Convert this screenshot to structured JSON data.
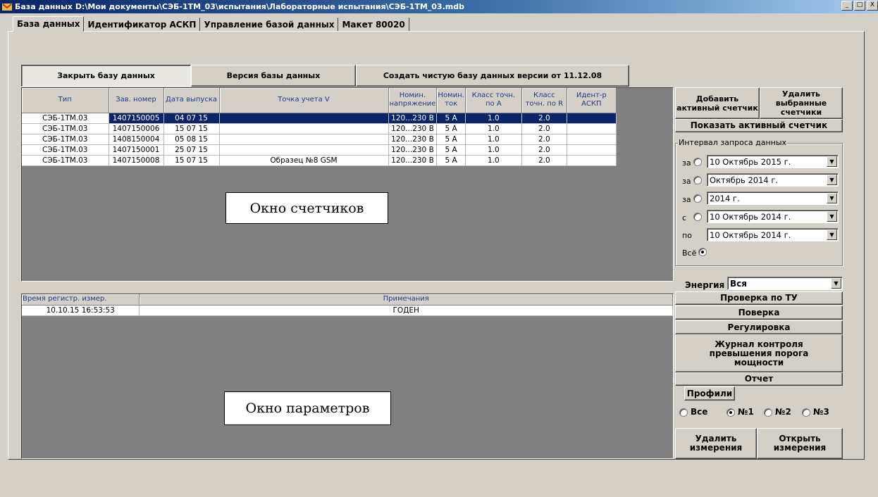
{
  "window": {
    "title": "База данных D:\\Мои документы\\СЭБ-1ТМ_03\\испытания\\Лабораторные испытания\\СЭБ-1ТМ_03.mdb",
    "controls": [
      "_",
      "□",
      "X"
    ]
  },
  "tabs": [
    {
      "label": "База данных",
      "active": true
    },
    {
      "label": "Идентификатор АСКП",
      "active": false
    },
    {
      "label": "Управление базой данных",
      "active": false
    },
    {
      "label": "Макет 80020",
      "active": false
    }
  ],
  "toolbar": {
    "close_db": "Закрыть базу данных",
    "db_version": "Версия базы данных",
    "create_db": "Создать чистую базу данных версии от 11.12.08"
  },
  "meters_table": {
    "columns": [
      "Тип",
      "Зав. номер",
      "Дата выпуска",
      "Точка учета V",
      "Номин. напряжение",
      "Номин. ток",
      "Класс точн. по А",
      "Класс точн. по R",
      "Идент-р АСКП"
    ],
    "rows": [
      [
        "СЭБ-1ТМ.03",
        "1407150005",
        "04 07 15",
        "",
        "120...230 В",
        "5 А",
        "1.0",
        "2.0",
        ""
      ],
      [
        "СЭБ-1ТМ.03",
        "1407150006",
        "15 07 15",
        "",
        "120...230 В",
        "5 А",
        "1.0",
        "2.0",
        ""
      ],
      [
        "СЭБ-1ТМ.03",
        "1408150004",
        "05 08 15",
        "",
        "120...230 В",
        "5 А",
        "1.0",
        "2.0",
        ""
      ],
      [
        "СЭБ-1ТМ.03",
        "1407150001",
        "25 07 15",
        "",
        "120...230 В",
        "5 А",
        "1.0",
        "2.0",
        ""
      ],
      [
        "СЭБ-1ТМ.03",
        "1407150008",
        "15 07 15",
        "Образец №8 GSM",
        "120...230 В",
        "5 А",
        "1.0",
        "2.0",
        ""
      ]
    ],
    "callout": "Окно счетчиков"
  },
  "params_table": {
    "columns": [
      "Время регистр. измер.",
      "Примечания"
    ],
    "rows": [
      [
        "10.10.15 16:53:53",
        "ГОДЕН"
      ]
    ],
    "callout": "Окно параметров"
  },
  "side": {
    "add_active": "Добавить активный счетчик",
    "delete_selected": "Удалить выбранные счетчики",
    "show_active": "Показать активный счетчик",
    "interval_label": "Интервал запроса данных",
    "intervals": [
      {
        "label": "за",
        "value": "10 Октябрь 2015 г.",
        "selected": false
      },
      {
        "label": "за",
        "value": "Октябрь 2014 г.",
        "selected": false
      },
      {
        "label": "за",
        "value": "2014 г.",
        "selected": false
      },
      {
        "label": "с",
        "value": "10 Октябрь 2014 г.",
        "selected": false
      },
      {
        "label": "по",
        "value": "10 Октябрь 2014 г."
      }
    ],
    "all_label": "Всё",
    "all_selected": true,
    "energy_label": "Энергия",
    "energy_value": "Вся",
    "tu_check": "Проверка по ТУ",
    "verification": "Поверка",
    "adjustment": "Регулировка",
    "power_log": "Журнал контроля превышения порога мощности",
    "report": "Отчет",
    "profiles": "Профили",
    "profile_options": [
      {
        "label": "Все",
        "selected": false
      },
      {
        "label": "№1",
        "selected": true
      },
      {
        "label": "№2",
        "selected": false
      },
      {
        "label": "№3",
        "selected": false
      }
    ],
    "delete_measurements": "Удалить измерения",
    "open_measurements": "Открыть измерения"
  },
  "colors": {
    "titlebar": "#0a246a",
    "selection": "#0a246a",
    "face": "#d4d0c8",
    "grid_bg": "#808080"
  }
}
